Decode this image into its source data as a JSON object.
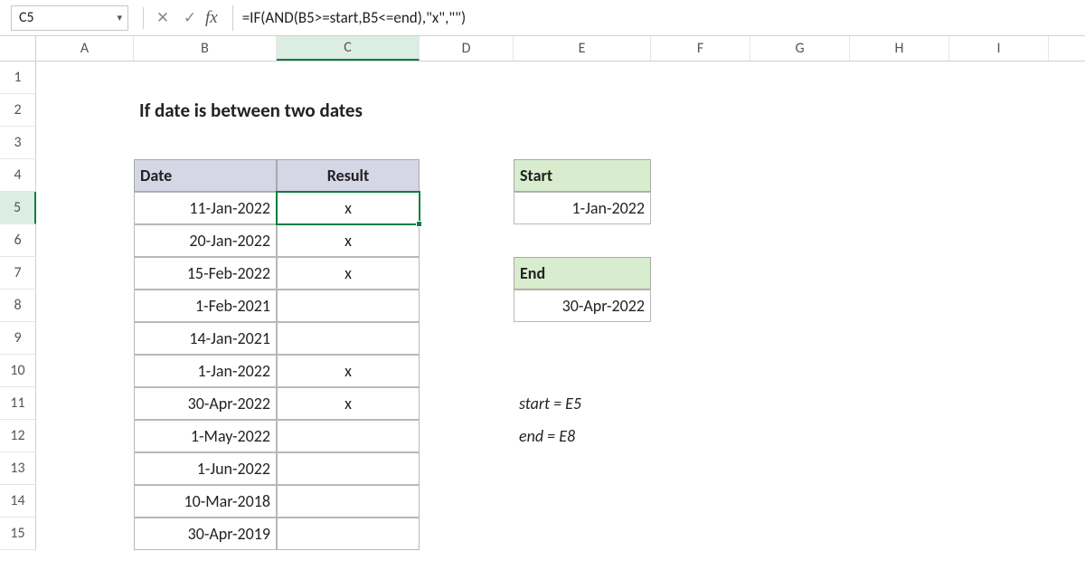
{
  "nameBox": "C5",
  "formula": "=IF(AND(B5>=start,B5<=end),\"x\",\"\")",
  "columns": [
    "A",
    "B",
    "C",
    "D",
    "E",
    "F",
    "G",
    "H",
    "I"
  ],
  "rows": [
    "1",
    "2",
    "3",
    "4",
    "5",
    "6",
    "7",
    "8",
    "9",
    "10",
    "11",
    "12",
    "13",
    "14",
    "15"
  ],
  "activeCol": "C",
  "activeRow": "5",
  "title": "If date is between two dates",
  "tableHeaders": {
    "date": "Date",
    "result": "Result"
  },
  "tableRows": [
    {
      "date": "11-Jan-2022",
      "result": "x"
    },
    {
      "date": "20-Jan-2022",
      "result": "x"
    },
    {
      "date": "15-Feb-2022",
      "result": "x"
    },
    {
      "date": "1-Feb-2021",
      "result": ""
    },
    {
      "date": "14-Jan-2021",
      "result": ""
    },
    {
      "date": "1-Jan-2022",
      "result": "x"
    },
    {
      "date": "30-Apr-2022",
      "result": "x"
    },
    {
      "date": "1-May-2022",
      "result": ""
    },
    {
      "date": "1-Jun-2022",
      "result": ""
    },
    {
      "date": "10-Mar-2018",
      "result": ""
    },
    {
      "date": "30-Apr-2019",
      "result": ""
    }
  ],
  "startLabel": "Start",
  "startValue": "1-Jan-2022",
  "endLabel": "End",
  "endValue": "30-Apr-2022",
  "note1": "start = E5",
  "note2": "end = E8",
  "fxLabel": "fx"
}
